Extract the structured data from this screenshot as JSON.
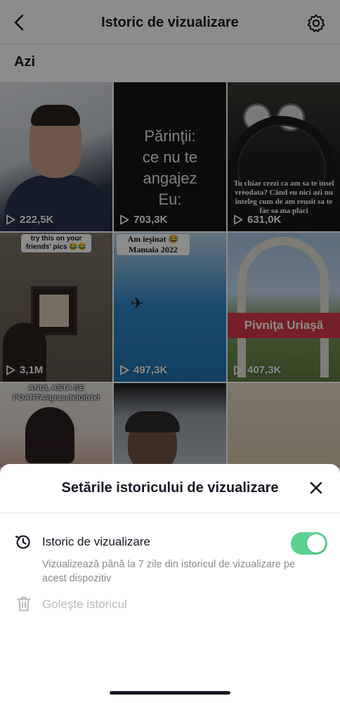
{
  "header": {
    "title": "Istoric de vizualizare"
  },
  "section_label": "Azi",
  "videos": [
    {
      "views": "222,5K"
    },
    {
      "views": "703,3K",
      "caption": "Părinţii:\nce nu te angajez\nEu:"
    },
    {
      "views": "631,0K",
      "caption": "Tu chiar crezi ca am sa te insel vreodata? Când eu nici azi nu înteleg cum de am reusit sa te fac sa ma placi"
    },
    {
      "views": "3,1M",
      "caption": "try this on your friends' pics 😂😂"
    },
    {
      "views": "497,3K",
      "caption": "Am ieşinat 😂 Mamaia 2022"
    },
    {
      "views": "407,3K",
      "caption": "Pivniţa Uriaşă"
    },
    {
      "caption": "ANUL ASTA SE POARTA#graseleluitrixi"
    },
    {},
    {}
  ],
  "sheet": {
    "title": "Setările istoricului de vizualizare",
    "history_label": "Istoric de vizualizare",
    "history_enabled": true,
    "history_desc": "Vizualizează până la 7 zile din istoricul de vizualizare pe acest dispozitiv",
    "clear_label": "Goleşte istoricul"
  },
  "colors": {
    "toggle_on": "#5bd192",
    "text_primary": "#161823",
    "text_secondary": "#8a8b91",
    "text_disabled": "#b9babd"
  }
}
